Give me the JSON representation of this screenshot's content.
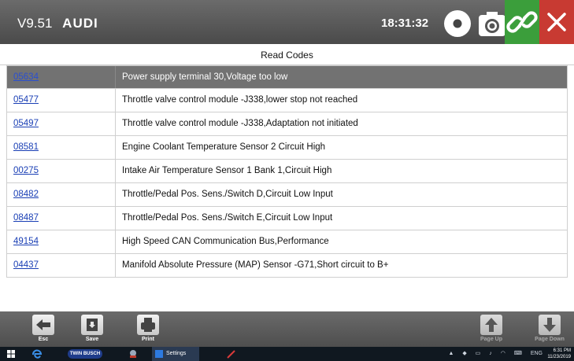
{
  "header": {
    "version": "V9.51",
    "brand": "AUDI",
    "clock": "18:31:32",
    "icons": [
      "record-icon",
      "camera-icon",
      "link-icon",
      "close-icon"
    ],
    "colors": {
      "link_bg": "#3b9e3b",
      "close_bg": "#c83a32"
    }
  },
  "section_title": "Read Codes",
  "codes": [
    {
      "code": "05634",
      "description": "Power supply terminal 30,Voltage too low",
      "selected": true
    },
    {
      "code": "05477",
      "description": "Throttle valve control module -J338,lower stop not reached"
    },
    {
      "code": "05497",
      "description": "Throttle valve control module -J338,Adaptation not initiated"
    },
    {
      "code": "08581",
      "description": "Engine Coolant Temperature Sensor 2 Circuit High"
    },
    {
      "code": "00275",
      "description": "Intake Air Temperature Sensor 1 Bank 1,Circuit High"
    },
    {
      "code": "08482",
      "description": "Throttle/Pedal Pos. Sens./Switch D,Circuit Low Input"
    },
    {
      "code": "08487",
      "description": "Throttle/Pedal Pos. Sens./Switch E,Circuit Low Input"
    },
    {
      "code": "49154",
      "description": "High Speed CAN Communication Bus,Performance"
    },
    {
      "code": "04437",
      "description": "Manifold Absolute Pressure (MAP) Sensor -G71,Short circuit to B+"
    }
  ],
  "toolbar": {
    "esc": "Esc",
    "save": "Save",
    "print": "Print",
    "page_up": "Page Up",
    "page_down": "Page Down"
  },
  "taskbar": {
    "app_label": "TWIN BUSCH",
    "settings_label": "Settings",
    "language": "ENG",
    "time": "6:31 PM",
    "date": "11/23/2019"
  }
}
